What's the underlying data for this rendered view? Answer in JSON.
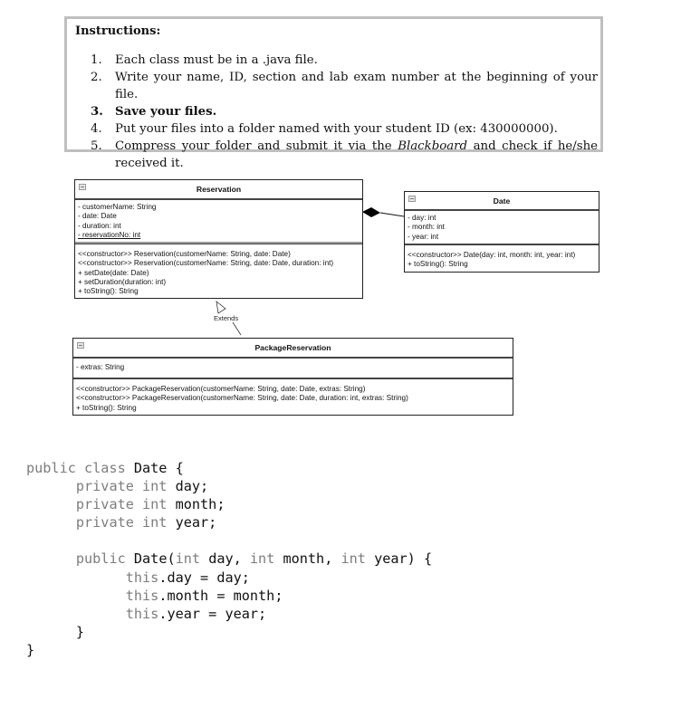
{
  "instructions": {
    "title": "Instructions:",
    "items": [
      {
        "num": "1.",
        "text": "Each class must be in a  .java file."
      },
      {
        "num": "2.",
        "text": "Write your name, ID, section and lab exam number at the beginning of your file."
      },
      {
        "num": "3.",
        "text": "Save your files."
      },
      {
        "num": "4.",
        "text": "Put your files into a folder named with your student ID (ex: 430000000)."
      },
      {
        "num": "5.",
        "text_before": "Compress your folder and submit it via the ",
        "text_em": "Blackboard",
        "text_after": " and check if he/she received it."
      }
    ]
  },
  "uml": {
    "reservation": {
      "name": "Reservation",
      "attributes": [
        "- customerName: String",
        "- date: Date",
        "- duration: int",
        "- reservationNo: int"
      ],
      "operations": [
        "<<constructor>> Reservation(customerName: String, date: Date)",
        "<<constructor>> Reservation(customerName: String, date: Date, duration: int)",
        "+ setDate(date: Date)",
        "+ setDuration(duration: int)",
        "+ toString(): String"
      ]
    },
    "date": {
      "name": "Date",
      "attributes": [
        "- day: int",
        "- month: int",
        "- year: int"
      ],
      "operations": [
        "<<constructor>> Date(day: int, month: int, year: int)",
        "+ toString(): String"
      ]
    },
    "package_reservation": {
      "name": "PackageReservation",
      "attributes": [
        "- extras: String"
      ],
      "operations": [
        "<<constructor>> PackageReservation(customerName: String, date: Date, extras: String)",
        "<<constructor>> PackageReservation(customerName: String, date: Date, duration: int, extras: String)",
        "+ toString(): String"
      ]
    },
    "relations": {
      "extends_label": "Extends",
      "composition": "Reservation ◆— Date",
      "inheritance": "PackageReservation —▷ Reservation"
    }
  },
  "code": {
    "lines": [
      {
        "kw1": "public class ",
        "rest": "Date {"
      },
      {
        "indent": "      ",
        "kw1": "private int ",
        "rest": "day;"
      },
      {
        "indent": "      ",
        "kw1": "private int ",
        "rest": "month;"
      },
      {
        "indent": "      ",
        "kw1": "private int ",
        "rest": "year;"
      },
      {
        "indent": "",
        "kw1": "",
        "rest": ""
      },
      {
        "indent": "      ",
        "kw1": "public ",
        "rest": "Date(",
        "kw2": "int ",
        "rest2": "day, ",
        "kw3": "int ",
        "rest3": "month, ",
        "kw4": "int ",
        "rest4": "year) {"
      },
      {
        "indent": "            ",
        "kw1": "this",
        "rest": ".day = day;"
      },
      {
        "indent": "            ",
        "kw1": "this",
        "rest": ".month = month;"
      },
      {
        "indent": "            ",
        "kw1": "this",
        "rest": ".year = year;"
      },
      {
        "indent": "      ",
        "kw1": "",
        "rest": "}"
      },
      {
        "indent": "",
        "kw1": "",
        "rest": "}"
      }
    ]
  }
}
